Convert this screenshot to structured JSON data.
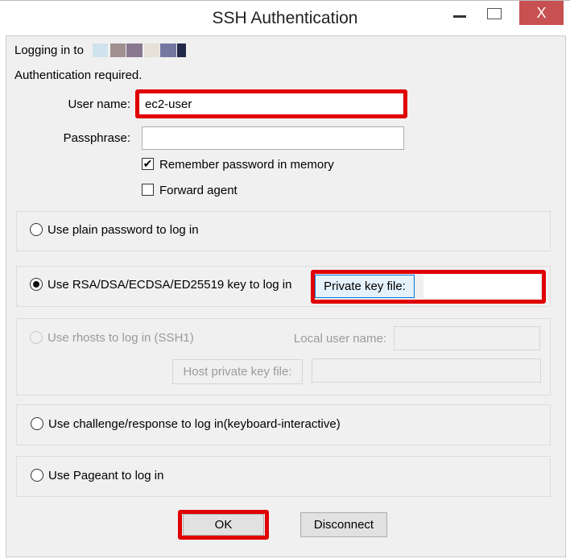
{
  "window": {
    "title": "SSH Authentication",
    "close_label": "X"
  },
  "header": {
    "logging_in_label": "Logging in to",
    "host_swatch_colors": [
      "#cfe3ee",
      "#a09090",
      "#8a7890",
      "#e6e0d6",
      "#7478a0",
      "#222848"
    ],
    "auth_status": "Authentication required."
  },
  "form": {
    "username_label": "User name:",
    "username_value": "ec2-user",
    "passphrase_label": "Passphrase:",
    "passphrase_value": "",
    "remember_label": "Remember password in memory",
    "remember_checked": true,
    "forward_label": "Forward agent",
    "forward_checked": false
  },
  "methods": {
    "plain": "Use plain password to log in",
    "key": "Use RSA/DSA/ECDSA/ED25519 key to log in",
    "private_key_button": "Private key file:",
    "private_key_value": "",
    "rhosts": "Use rhosts to log in (SSH1)",
    "local_user_label": "Local user name:",
    "host_key_button": "Host private key file:",
    "challenge": "Use challenge/response to log in(keyboard-interactive)",
    "pageant": "Use Pageant to log in",
    "selected": "key"
  },
  "buttons": {
    "ok": "OK",
    "disconnect": "Disconnect"
  },
  "highlight_color": "#e00000"
}
